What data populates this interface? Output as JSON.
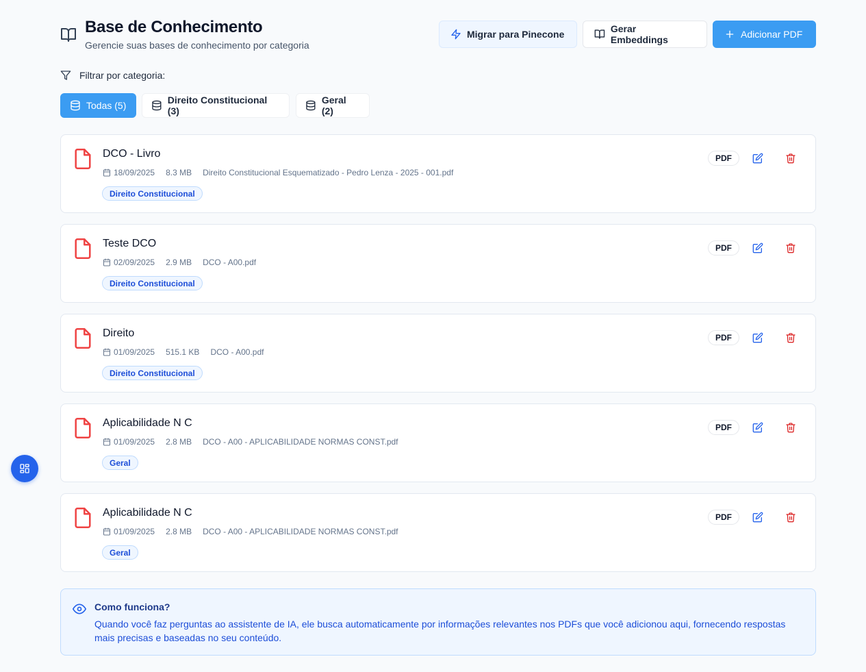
{
  "header": {
    "title": "Base de Conhecimento",
    "subtitle": "Gerencie suas bases de conhecimento por categoria"
  },
  "actions": {
    "migrate_label": "Migrar para Pinecone",
    "embeddings_label": "Gerar Embeddings",
    "add_label": "Adicionar PDF"
  },
  "filter": {
    "label": "Filtrar por categoria:",
    "chips": [
      {
        "label": "Todas (5)",
        "active": true
      },
      {
        "label": "Direito Constitucional (3)",
        "active": false
      },
      {
        "label": "Geral (2)",
        "active": false
      }
    ]
  },
  "documents": [
    {
      "title": "DCO - Livro",
      "date": "18/09/2025",
      "size": "8.3 MB",
      "file": "Direito Constitucional Esquematizado - Pedro Lenza - 2025 - 001.pdf",
      "category": "Direito Constitucional",
      "badge": "PDF"
    },
    {
      "title": "Teste DCO",
      "date": "02/09/2025",
      "size": "2.9 MB",
      "file": "DCO - A00.pdf",
      "category": "Direito Constitucional",
      "badge": "PDF"
    },
    {
      "title": "Direito",
      "date": "01/09/2025",
      "size": "515.1 KB",
      "file": "DCO - A00.pdf",
      "category": "Direito Constitucional",
      "badge": "PDF"
    },
    {
      "title": "Aplicabilidade N C",
      "date": "01/09/2025",
      "size": "2.8 MB",
      "file": "DCO - A00 - APLICABILIDADE NORMAS CONST.pdf",
      "category": "Geral",
      "badge": "PDF"
    },
    {
      "title": "Aplicabilidade N C",
      "date": "01/09/2025",
      "size": "2.8 MB",
      "file": "DCO - A00 - APLICABILIDADE NORMAS CONST.pdf",
      "category": "Geral",
      "badge": "PDF"
    }
  ],
  "info": {
    "title": "Como funciona?",
    "text": "Quando você faz perguntas ao assistente de IA, ele busca automaticamente por informações relevantes nos PDFs que você adicionou aqui, fornecendo respostas mais precisas e baseadas no seu conteúdo."
  },
  "colors": {
    "primary": "#3b9cf2",
    "accent_blue": "#2563eb",
    "danger": "#dc2626",
    "doc_icon": "#ef4444"
  },
  "icons": {
    "header": "book-open-icon",
    "migrate": "zap-icon",
    "embeddings": "book-open-icon",
    "add": "plus-icon",
    "filter": "filter-icon",
    "chip": "database-icon",
    "document": "file-icon",
    "date": "calendar-icon",
    "edit": "edit-icon",
    "delete": "trash-icon",
    "fab": "grid-icon",
    "info": "eye-icon"
  }
}
